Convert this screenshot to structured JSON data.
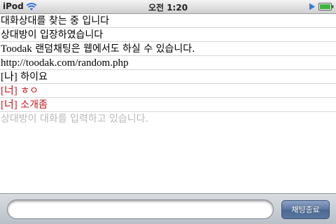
{
  "status_bar": {
    "carrier": "iPod",
    "time": "오전 1:20",
    "icons": [
      "wifi-icon",
      "play-icon",
      "battery-icon"
    ]
  },
  "chat": {
    "messages": [
      {
        "text": "대화상대를 찾는 중 입니다"
      },
      {
        "text": "상대방이 입장하였습니다"
      },
      {
        "prefix": "Toodak",
        "text": " 랜덤채팅은 웹에서도 하실 수 있습니다."
      },
      {
        "text": "http://toodak.com/random.php"
      },
      {
        "tag": "[나]",
        "text": " 하이요"
      },
      {
        "tag": "[너]",
        "text": " ㅎㅇ"
      },
      {
        "tag": "[너]",
        "text": " 소개좀"
      },
      {
        "text": "상대방이 대화를 입력하고 있습니다."
      }
    ]
  },
  "input_bar": {
    "input_value": "",
    "end_button_label": "채팅종료"
  },
  "colors": {
    "partner_text": "#c4161c",
    "typing_status": "#b9b9b9",
    "button_blue": "#5b779f"
  }
}
